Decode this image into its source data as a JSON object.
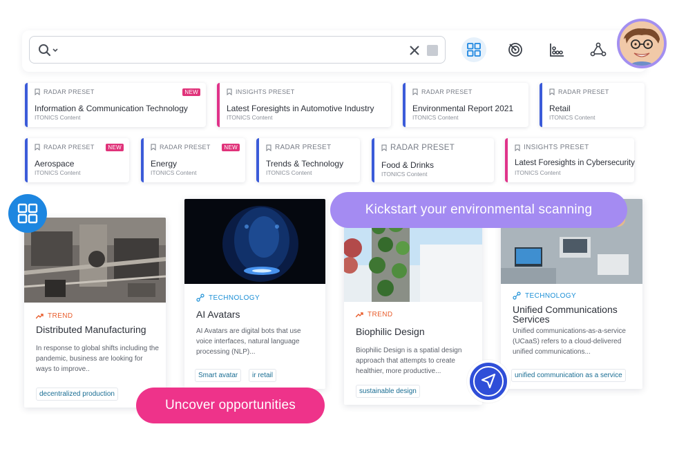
{
  "search": {
    "value": "",
    "placeholder": ""
  },
  "toolbar": {
    "views": [
      {
        "icon": "grid-icon",
        "active": true
      },
      {
        "icon": "radar-icon",
        "active": false
      },
      {
        "icon": "chart-icon",
        "active": false
      },
      {
        "icon": "network-icon",
        "active": false
      }
    ]
  },
  "presets": [
    {
      "kind": "RADAR PRESET",
      "title": "Information & Communication Technology",
      "source": "ITONICS Content",
      "is_new": true,
      "new_label": "NEW",
      "accent": "#3b5bd9"
    },
    {
      "kind": "INSIGHTS PRESET",
      "title": "Latest Foresights in Automotive Industry",
      "source": "ITONICS Content",
      "is_new": false,
      "accent": "#e0338a"
    },
    {
      "kind": "RADAR PRESET",
      "title": "Environmental Report 2021",
      "source": "ITONICS Content",
      "is_new": false,
      "accent": "#3b5bd9"
    },
    {
      "kind": "RADAR PRESET",
      "title": "Retail",
      "source": "ITONICS Content",
      "is_new": false,
      "accent": "#3b5bd9"
    },
    {
      "kind": "RADAR PRESET",
      "title": "Aerospace",
      "source": "ITONICS Content",
      "is_new": true,
      "new_label": "NEW",
      "accent": "#3b5bd9"
    },
    {
      "kind": "RADAR PRESET",
      "title": "Energy",
      "source": "ITONICS Content",
      "is_new": true,
      "new_label": "NEW",
      "accent": "#3b5bd9"
    },
    {
      "kind": "RADAR PRESET",
      "title": "Trends & Technology",
      "source": "ITONICS Content",
      "is_new": false,
      "accent": "#3b5bd9"
    },
    {
      "kind": "RADAR PRESET",
      "title": "Food & Drinks",
      "source": "ITONICS Content",
      "is_new": false,
      "accent": "#3b5bd9"
    },
    {
      "kind": "INSIGHTS PRESET",
      "title": "Latest Foresights in Cybersecurity",
      "source": "ITONICS Content",
      "is_new": false,
      "accent": "#e0338a"
    }
  ],
  "cards": [
    {
      "category": "TREND",
      "title": "Distributed Manufacturing",
      "description": "In response to global shifts including the pandemic, business are looking for ways to improve..",
      "tags": [
        "decentralized production"
      ]
    },
    {
      "category": "TECHNOLOGY",
      "title": "AI Avatars",
      "description": "AI Avatars are digital bots that use voice interfaces, natural language processing (NLP)...",
      "tags": [
        "Smart avatar",
        "ir retail"
      ]
    },
    {
      "category": "TREND",
      "title": "Biophilic Design",
      "description": "Biophilic Design is a spatial design approach that attempts to create healthier, more productive...",
      "tags": [
        "sustainable design"
      ]
    },
    {
      "category": "TECHNOLOGY",
      "title": "Unified Communications Services",
      "description": "Unified communications-as-a-service (UCaaS) refers to a cloud-delivered unified communications...",
      "tags": [
        "unified communication as a service"
      ]
    }
  ],
  "callouts": {
    "kickstart": "Kickstart your environmental scanning",
    "uncover": "Uncover opportunities"
  },
  "colors": {
    "radar_accent": "#3b5bd9",
    "insights_accent": "#e0338a",
    "new_badge": "#e0337a",
    "trend": "#e85b2a",
    "technology": "#1b8fd6",
    "kickstart_pill": "#a48bf2",
    "uncover_pill": "#ee338a",
    "fab_grid": "#1d86e0",
    "fab_send": "#2f4ed8"
  }
}
